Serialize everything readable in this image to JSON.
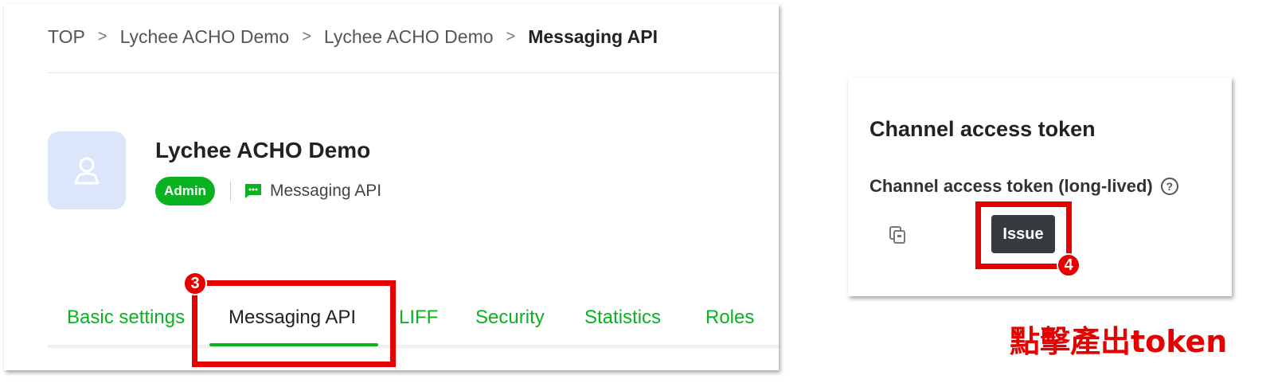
{
  "breadcrumb": {
    "items": [
      "TOP",
      "Lychee ACHO Demo",
      "Lychee ACHO Demo"
    ],
    "separator": ">",
    "current": "Messaging API"
  },
  "channel": {
    "name": "Lychee ACHO Demo",
    "role_badge": "Admin",
    "type_label": "Messaging API",
    "avatar_icon": "user-icon"
  },
  "tabs": [
    {
      "label": "Basic settings",
      "active": false
    },
    {
      "label": "Messaging API",
      "active": true
    },
    {
      "label": "LIFF",
      "active": false
    },
    {
      "label": "Security",
      "active": false
    },
    {
      "label": "Statistics",
      "active": false
    },
    {
      "label": "Roles",
      "active": false
    }
  ],
  "annotations": {
    "step3": "3",
    "step4": "4",
    "caption": "點擊產出token"
  },
  "token_panel": {
    "title": "Channel access token",
    "field_label": "Channel access token (long-lived)",
    "help_icon": "?",
    "issue_label": "Issue"
  },
  "colors": {
    "brand_green": "#08b31f",
    "highlight_red": "#e60000",
    "button_dark": "#363b40"
  }
}
